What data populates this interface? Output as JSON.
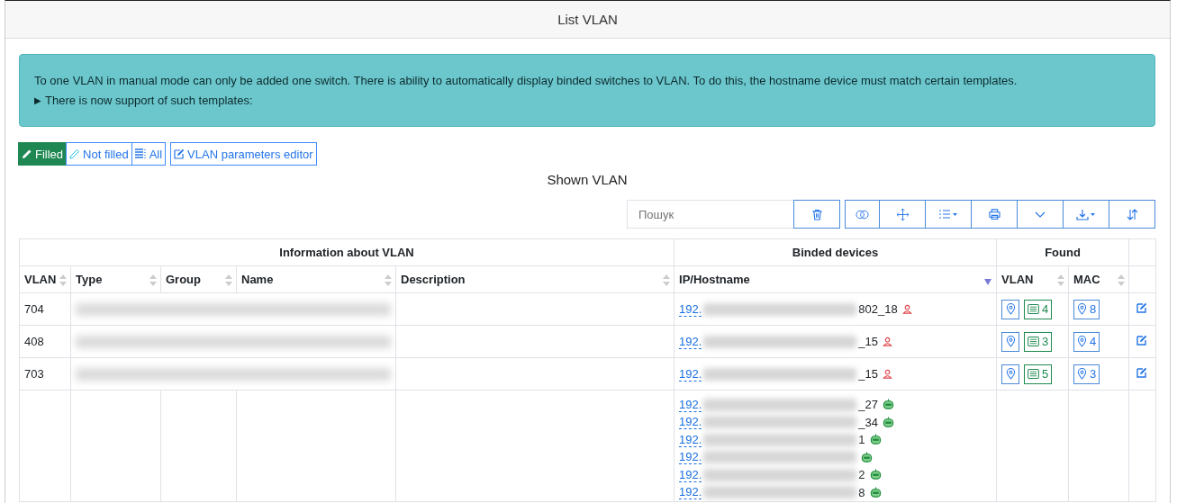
{
  "header": {
    "title": "List VLAN"
  },
  "alert": {
    "text": "To one VLAN in manual mode can only be added one switch. There is ability to automatically display binded switches to VLAN. To do this, the hostname device must match certain templates.",
    "toggle": "▶",
    "details": "There is now support of such templates:"
  },
  "filters": [
    {
      "label": "Filled",
      "kind": "filled",
      "selected": true
    },
    {
      "label": "Not filled",
      "kind": "not-filled",
      "selected": false
    },
    {
      "label": "All",
      "kind": "all",
      "selected": false
    }
  ],
  "editor_button": "VLAN parameters editor",
  "section_title": "Shown VLAN",
  "search": {
    "placeholder": "Пошук"
  },
  "table": {
    "groups": [
      {
        "label": "Information about VLAN"
      },
      {
        "label": "Binded devices"
      },
      {
        "label": "Found"
      }
    ],
    "columns": [
      {
        "label": "VLAN",
        "sorted": false
      },
      {
        "label": "Type",
        "sorted": false
      },
      {
        "label": "Group",
        "sorted": false
      },
      {
        "label": "Name",
        "sorted": false
      },
      {
        "label": "Description",
        "sorted": false
      },
      {
        "label": "IP/Hostname",
        "sorted": true
      },
      {
        "label": "VLAN",
        "sorted": false
      },
      {
        "label": "MAC",
        "sorted": false
      }
    ],
    "rows": [
      {
        "vlan": "704",
        "devices": [
          {
            "ip": "192.",
            "suffix": "802_18",
            "kind": "user"
          }
        ],
        "found_vlan": "4",
        "found_mac": "8"
      },
      {
        "vlan": "408",
        "devices": [
          {
            "ip": "192.",
            "suffix": "_15",
            "kind": "user"
          }
        ],
        "found_vlan": "3",
        "found_mac": "4"
      },
      {
        "vlan": "703",
        "devices": [
          {
            "ip": "192.",
            "suffix": "_15",
            "kind": "user"
          }
        ],
        "found_vlan": "5",
        "found_mac": "3"
      },
      {
        "vlan": "",
        "devices": [
          {
            "ip": "192.",
            "suffix": "_27",
            "kind": "bot"
          },
          {
            "ip": "192.",
            "suffix": "_34",
            "kind": "bot"
          },
          {
            "ip": "192.",
            "suffix": "1",
            "kind": "bot"
          },
          {
            "ip": "192.",
            "kind": "bot"
          },
          {
            "ip": "192.",
            "suffix": "2",
            "kind": "bot"
          },
          {
            "ip": "192.",
            "suffix": "8",
            "kind": "bot"
          }
        ]
      }
    ]
  }
}
